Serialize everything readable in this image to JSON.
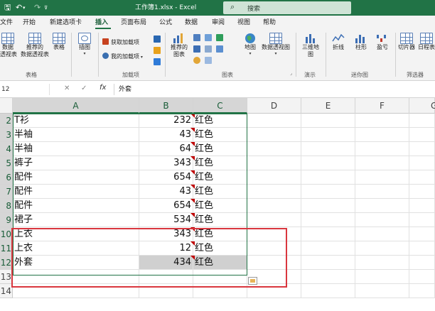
{
  "titlebar": {
    "save_icon": "save-icon",
    "undo_icon": "undo-icon",
    "redo_icon": "redo-icon",
    "title": "工作簿1.xlsx  -  Excel",
    "search_placeholder": "搜索"
  },
  "ribbon_tabs": [
    "文件",
    "开始",
    "新建选项卡",
    "插入",
    "页面布局",
    "公式",
    "数据",
    "审阅",
    "视图",
    "帮助"
  ],
  "ribbon_tabs_active": "插入",
  "ribbon": {
    "pivot_label_1": "数据",
    "pivot_label_2": "透视表",
    "rec_pivot_label_1": "推荐的",
    "rec_pivot_label_2": "数据透视表",
    "table_label": "表格",
    "group_tables": "表格",
    "illustrations_label": "插图",
    "get_addins": "获取加载项",
    "my_addins": "我的加载项",
    "group_addins": "加载项",
    "rec_charts_label_1": "推荐的",
    "rec_charts_label_2": "图表",
    "map_label": "地图",
    "pivot_chart_label": "数据透视图",
    "group_charts": "图表",
    "map3d_label_1": "三维地",
    "map3d_label_2": "图",
    "group_tours": "演示",
    "sparkline_line": "折线",
    "sparkline_column": "柱形",
    "sparkline_winloss": "盈亏",
    "group_sparklines": "迷你图",
    "slicer_label": "切片器",
    "timeline_label": "日程表",
    "group_filters": "筛选器"
  },
  "formula_bar": {
    "name_box": "12",
    "cancel": "✕",
    "enter": "✓",
    "fx": "fx",
    "content": "外套"
  },
  "columns": [
    "A",
    "B",
    "C",
    "D",
    "E",
    "F",
    "G"
  ],
  "rows": [
    {
      "num": "2",
      "a": "T衫",
      "b": "232",
      "c": "红色"
    },
    {
      "num": "3",
      "a": "半袖",
      "b": "43",
      "c": "红色"
    },
    {
      "num": "4",
      "a": "半袖",
      "b": "64",
      "c": "红色"
    },
    {
      "num": "5",
      "a": "裤子",
      "b": "343",
      "c": "红色"
    },
    {
      "num": "6",
      "a": "配件",
      "b": "654",
      "c": "红色"
    },
    {
      "num": "7",
      "a": "配件",
      "b": "43",
      "c": "红色"
    },
    {
      "num": "8",
      "a": "配件",
      "b": "654",
      "c": "红色"
    },
    {
      "num": "9",
      "a": "裙子",
      "b": "534",
      "c": "红色"
    },
    {
      "num": "10",
      "a": "上衣",
      "b": "343",
      "c": "红色"
    },
    {
      "num": "11",
      "a": "上衣",
      "b": "12",
      "c": "红色"
    },
    {
      "num": "12",
      "a": "外套",
      "b": "434",
      "c": "红色"
    },
    {
      "num": "13",
      "a": "",
      "b": "",
      "c": ""
    },
    {
      "num": "14",
      "a": "",
      "b": "",
      "c": ""
    }
  ],
  "colors": {
    "excel_green": "#217346",
    "highlight_red": "#d9363e",
    "comment_marker": "#c00000"
  }
}
